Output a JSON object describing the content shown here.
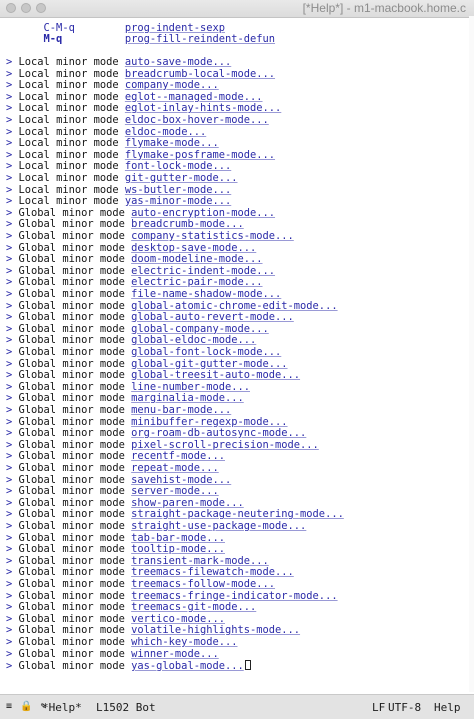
{
  "window": {
    "title": "[*Help*] - m1-macbook.home.c"
  },
  "buffer": {
    "header_lines": [
      {
        "key": "C-M-q",
        "command": "prog-indent-sexp"
      },
      {
        "key": "M-q",
        "command": "prog-fill-reindent-defun"
      }
    ],
    "arrow_glyph": ">",
    "local_prefix": "Local minor mode ",
    "global_prefix": "Global minor mode ",
    "local_modes": [
      "auto-save-mode...",
      "breadcrumb-local-mode...",
      "company-mode...",
      "eglot--managed-mode...",
      "eglot-inlay-hints-mode...",
      "eldoc-box-hover-mode...",
      "eldoc-mode...",
      "flymake-mode...",
      "flymake-posframe-mode...",
      "font-lock-mode...",
      "git-gutter-mode...",
      "ws-butler-mode...",
      "yas-minor-mode..."
    ],
    "global_modes": [
      "auto-encryption-mode...",
      "breadcrumb-mode...",
      "company-statistics-mode...",
      "desktop-save-mode...",
      "doom-modeline-mode...",
      "electric-indent-mode...",
      "electric-pair-mode...",
      "file-name-shadow-mode...",
      "global-atomic-chrome-edit-mode...",
      "global-auto-revert-mode...",
      "global-company-mode...",
      "global-eldoc-mode...",
      "global-font-lock-mode...",
      "global-git-gutter-mode...",
      "global-treesit-auto-mode...",
      "line-number-mode...",
      "marginalia-mode...",
      "menu-bar-mode...",
      "minibuffer-regexp-mode...",
      "org-roam-db-autosync-mode...",
      "pixel-scroll-precision-mode...",
      "recentf-mode...",
      "repeat-mode...",
      "savehist-mode...",
      "server-mode...",
      "show-paren-mode...",
      "straight-package-neutering-mode...",
      "straight-use-package-mode...",
      "tab-bar-mode...",
      "tooltip-mode...",
      "transient-mark-mode...",
      "treemacs-filewatch-mode...",
      "treemacs-follow-mode...",
      "treemacs-fringe-indicator-mode...",
      "treemacs-git-mode...",
      "vertico-mode...",
      "volatile-highlights-mode...",
      "which-key-mode...",
      "winner-mode...",
      "yas-global-mode..."
    ]
  },
  "modeline": {
    "icons": "≡ 🔒 ✎",
    "buffer_name": "*Help*",
    "position": "L1502 Bot",
    "eol": "LF",
    "encoding": "UTF-8",
    "major_mode": "Help"
  },
  "colors": {
    "link": "#2a2aa8",
    "text": "#151515",
    "modeline_bg": "#e3e3e3",
    "titlebar_bg": "#dcdcdc"
  }
}
